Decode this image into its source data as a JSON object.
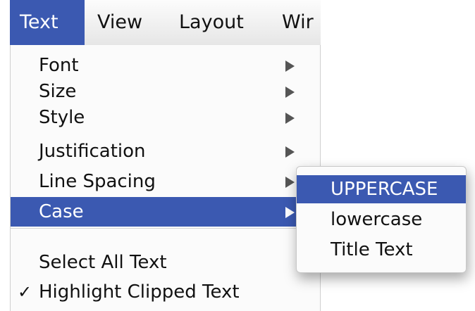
{
  "menubar": {
    "items": [
      "Text",
      "View",
      "Layout",
      "Wir"
    ],
    "active": "Text"
  },
  "menu": {
    "items": [
      {
        "label": "Font",
        "has_submenu": true
      },
      {
        "label": "Size",
        "has_submenu": true
      },
      {
        "label": "Style",
        "has_submenu": true
      },
      {
        "label": "Justification",
        "has_submenu": true
      },
      {
        "label": "Line Spacing",
        "has_submenu": true
      },
      {
        "label": "Case",
        "has_submenu": true,
        "selected": true
      },
      {
        "label": "Select All Text"
      },
      {
        "label": "Highlight Clipped Text",
        "checked": true
      }
    ],
    "check_mark": "✓"
  },
  "submenu": {
    "items": [
      {
        "label": "UPPERCASE",
        "selected": true
      },
      {
        "label": "lowercase"
      },
      {
        "label": "Title Text"
      }
    ]
  },
  "colors": {
    "highlight": "#3b59b1",
    "menu_background": "#fbfbfb",
    "text": "#111111"
  }
}
